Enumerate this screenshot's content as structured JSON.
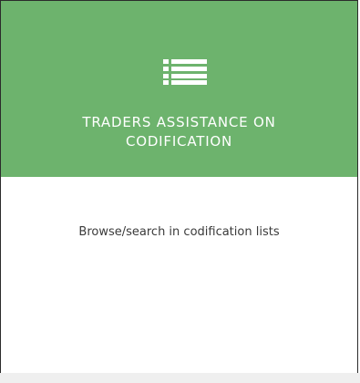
{
  "card": {
    "icon": "list-icon",
    "title": "TRADERS ASSISTANCE ON\nCODIFICATION",
    "description": "Browse/search in codification lists",
    "header_color": "#6db36d"
  }
}
